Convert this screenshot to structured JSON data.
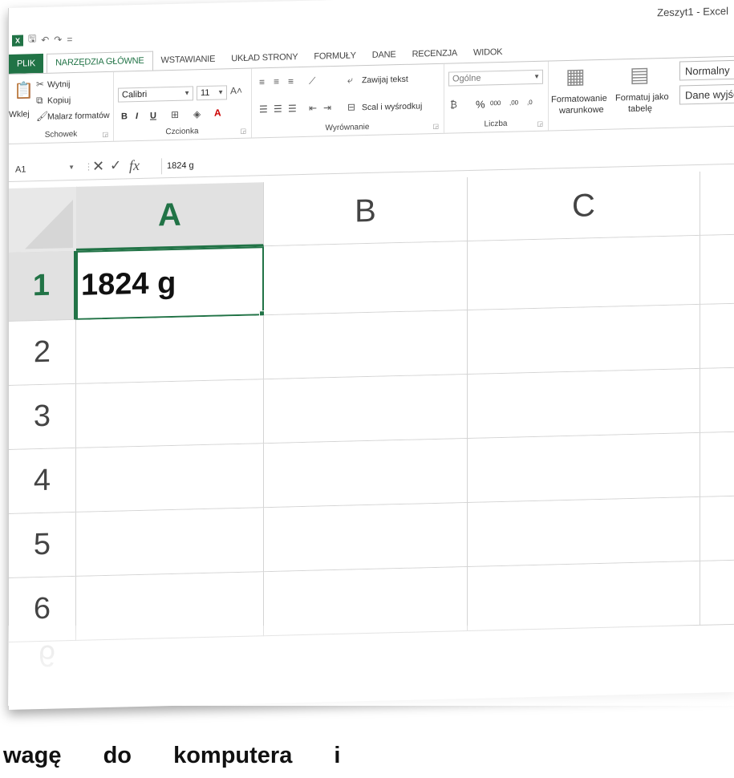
{
  "window": {
    "title": "Zeszyt1 - Excel",
    "app_icon": "X"
  },
  "qat": {
    "save": "🖫",
    "undo": "↶",
    "redo": "↷",
    "more": "="
  },
  "tabs": [
    {
      "label": "PLIK"
    },
    {
      "label": "NARZĘDZIA GŁÓWNE"
    },
    {
      "label": "WSTAWIANIE"
    },
    {
      "label": "UKŁAD STRONY"
    },
    {
      "label": "FORMUŁY"
    },
    {
      "label": "DANE"
    },
    {
      "label": "RECENZJA"
    },
    {
      "label": "WIDOK"
    }
  ],
  "ribbon": {
    "clipboard": {
      "paste": "Wklej",
      "cut": "Wytnij",
      "copy": "Kopiuj",
      "format_painter": "Malarz formatów",
      "label": "Schowek"
    },
    "font": {
      "name": "Calibri",
      "size": "11",
      "bold": "B",
      "italic": "I",
      "underline": "U",
      "label": "Czcionka"
    },
    "alignment": {
      "wrap": "Zawijaj tekst",
      "merge": "Scal i wyśrodkuj",
      "label": "Wyrównanie"
    },
    "number": {
      "format": "Ogólne",
      "percent": "%",
      "thousands": "000",
      "inc_dec": ",00",
      "dec_dec": ",0",
      "label": "Liczba"
    },
    "styles": {
      "conditional_1": "Formatowanie",
      "conditional_2": "warunkowe",
      "table_1": "Formatuj jako",
      "table_2": "tabelę",
      "normal": "Normalny",
      "output": "Dane wyjśc"
    }
  },
  "formula_bar": {
    "name_box": "A1",
    "fx": "fx",
    "value": "1824 g"
  },
  "columns": [
    "A",
    "B",
    "C"
  ],
  "rows": [
    "1",
    "2",
    "3",
    "4",
    "5",
    "6"
  ],
  "cells": {
    "A1": "1824 g"
  },
  "caption": "wagę do komputera i"
}
